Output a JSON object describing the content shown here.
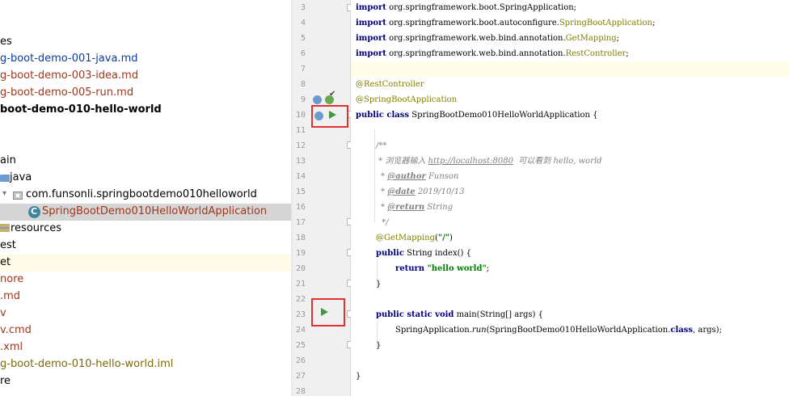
{
  "tree": {
    "items": [
      {
        "label": "es",
        "color": "black"
      },
      {
        "label": "g-boot-demo-001-java.md",
        "color": "blue"
      },
      {
        "label": "g-boot-demo-003-idea.md",
        "color": "red"
      },
      {
        "label": "g-boot-demo-005-run.md",
        "color": "red"
      },
      {
        "label": "boot-demo-010-hello-world",
        "color": "black"
      },
      {
        "label": "ain",
        "color": "black"
      },
      {
        "label": "java",
        "color": "black"
      },
      {
        "label": "com.funsonli.springbootdemo010helloworld",
        "color": "black"
      },
      {
        "label": "SpringBootDemo010HelloWorldApplication",
        "color": "red"
      },
      {
        "label": "resources",
        "color": "black"
      },
      {
        "label": "est",
        "color": "black"
      },
      {
        "label": "et",
        "color": "black"
      },
      {
        "label": "nore",
        "color": "red"
      },
      {
        "label": ".md",
        "color": "red"
      },
      {
        "label": "v",
        "color": "red"
      },
      {
        "label": "v.cmd",
        "color": "red"
      },
      {
        "label": ".xml",
        "color": "red"
      },
      {
        "label": "g-boot-demo-010-hello-world.iml",
        "color": "olive"
      },
      {
        "label": "re",
        "color": "black"
      }
    ]
  },
  "editor": {
    "line_numbers": [
      "3",
      "4",
      "5",
      "6",
      "7",
      "8",
      "9",
      "10",
      "11",
      "12",
      "13",
      "14",
      "15",
      "16",
      "17",
      "18",
      "19",
      "20",
      "21",
      "22",
      "23",
      "24",
      "25",
      "26",
      "27",
      "28"
    ],
    "lines": {
      "l3_kw": "import",
      "l3_rest": " org.springframework.boot.SpringApplication;",
      "l4_kw": "import",
      "l4_rest": " org.springframework.boot.autoconfigure.",
      "l4_ann": "SpringBootApplication",
      "l4_end": ";",
      "l5_kw": "import",
      "l5_rest": " org.springframework.web.bind.annotation.",
      "l5_ann": "GetMapping",
      "l5_end": ";",
      "l6_kw": "import",
      "l6_rest": " org.springframework.web.bind.annotation.",
      "l6_ann": "RestController",
      "l6_end": ";",
      "l9": "@RestController",
      "l10": "@SpringBootApplication",
      "l11_kw": "public class",
      "l11_rest": " SpringBootDemo010HelloWorldApplication {",
      "l13": "/**",
      "l14_pre": " * 浏览器输入 ",
      "l14_link": "http://localhost:8080",
      "l14_post": "  可以看到 hello, world",
      "l15_tag": "@author",
      "l15_rest": " Funson",
      "l16_tag": "@date",
      "l16_rest": " 2019/10/13",
      "l17_tag": "@return",
      "l17_rest": " String",
      "l18": " */",
      "l19_ann": "@GetMapping",
      "l19_open": "(",
      "l19_str": "\"/\"",
      "l19_close": ")",
      "l20_kw": "public",
      "l20_rest": " String index() {",
      "l21_kw": "return",
      "l21_str": " \"hello world\"",
      "l21_end": ";",
      "l22": "}",
      "l24_kw": "public static void",
      "l24_rest": " main(String[] args) {",
      "l25_pre": "SpringApplication.",
      "l25_method": "run",
      "l25_mid": "(SpringBootDemo010HelloWorldApplication.",
      "l25_kw": "class",
      "l25_end": ", args);",
      "l26": "}",
      "l28": "}"
    }
  },
  "colors": {
    "keyword": "#000080",
    "annotation": "#808000",
    "string": "#008000",
    "comment": "#808080",
    "highlight_box": "#e03030",
    "run_icon": "#3c9b3c"
  }
}
